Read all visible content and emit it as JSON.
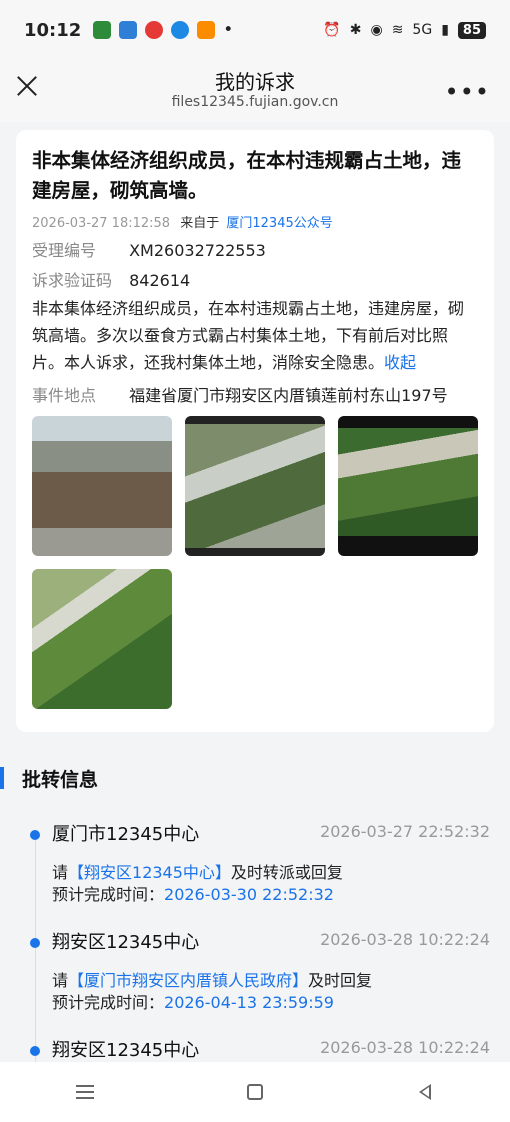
{
  "status_bar": {
    "time": "10:12",
    "signal_text": "5G",
    "battery": "85"
  },
  "nav": {
    "title": "我的诉求",
    "subtitle": "files12345.fujian.gov.cn"
  },
  "complaint": {
    "title": "非本集体经济组织成员，在本村违规霸占土地，违建房屋，砌筑高墙。",
    "datetime": "2026-03-27 18:12:58",
    "source_prefix": "来自于",
    "source": "厦门12345公众号",
    "case_label": "受理编号",
    "case_no": "XM26032722553",
    "code_label": "诉求验证码",
    "code": "842614",
    "body": "非本集体经济组织成员，在本村违规霸占土地，违建房屋，砌筑高墙。多次以蚕食方式霸占村集体土地，下有前后对比照片。本人诉求，还我村集体土地，消除安全隐患。",
    "collapse": "收起",
    "location_label": "事件地点",
    "location": "福建省厦门市翔安区内厝镇莲前村东山197号"
  },
  "transfer": {
    "section_title": "批转信息",
    "items": [
      {
        "org": "厦门市12345中心",
        "time": "2026-03-27 22:52:32",
        "note_prefix": "请",
        "note_org": "【翔安区12345中心】",
        "note_suffix": "及时转派或回复",
        "deadline_label": "预计完成时间：",
        "deadline": "2026-03-30 22:52:32"
      },
      {
        "org": "翔安区12345中心",
        "time": "2026-03-28 10:22:24",
        "note_prefix": "请",
        "note_org": "【厦门市翔安区内厝镇人民政府】",
        "note_suffix": "及时回复",
        "deadline_label": "预计完成时间：",
        "deadline": "2026-04-13 23:59:59"
      },
      {
        "org": "翔安区12345中心",
        "time": "2026-03-28 10:22:24"
      }
    ]
  },
  "colors": {
    "accent": "#1a73e8",
    "muted": "#999999"
  }
}
